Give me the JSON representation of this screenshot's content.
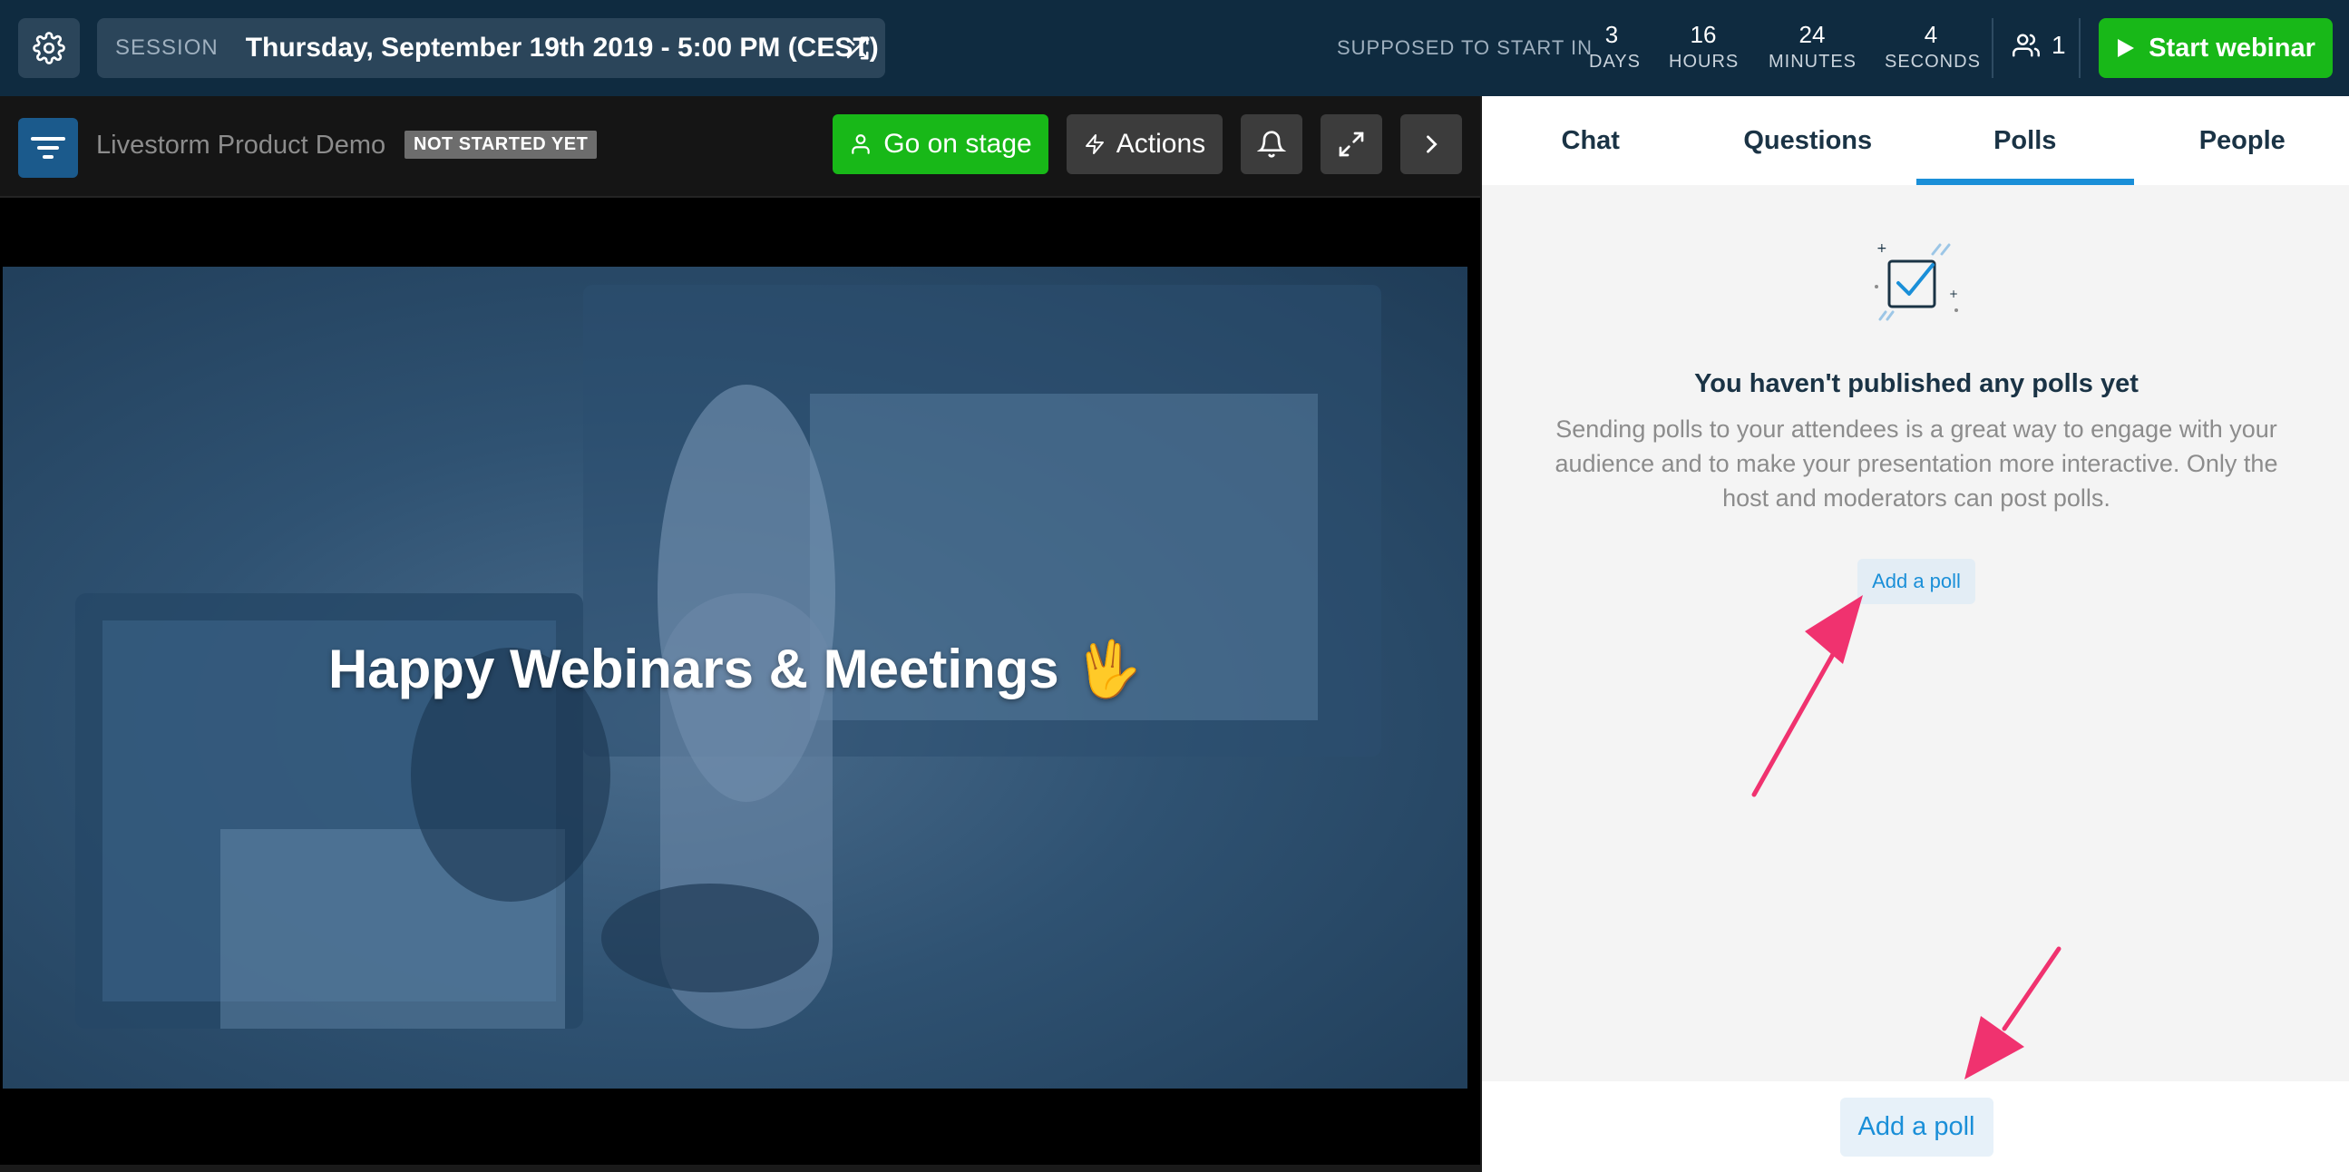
{
  "topbar": {
    "session_label": "SESSION",
    "session_date": "Thursday, September 19th 2019 - 5:00 PM (CEST)",
    "start_label": "SUPPOSED TO START IN",
    "countdown": [
      {
        "value": "3",
        "unit": "DAYS"
      },
      {
        "value": "16",
        "unit": "HOURS"
      },
      {
        "value": "24",
        "unit": "MINUTES"
      },
      {
        "value": "4",
        "unit": "SECONDS"
      }
    ],
    "attendee_count": "1",
    "start_button": "Start webinar"
  },
  "stage": {
    "event_name": "Livestorm Product Demo",
    "status_badge": "NOT STARTED YET",
    "go_on_stage": "Go on stage",
    "actions": "Actions",
    "video_title": "Happy Webinars & Meetings",
    "video_emoji": "🖖"
  },
  "panel": {
    "tabs": [
      {
        "label": "Chat"
      },
      {
        "label": "Questions"
      },
      {
        "label": "Polls",
        "active": true
      },
      {
        "label": "People"
      }
    ],
    "empty_title": "You haven't published any polls yet",
    "empty_desc": "Sending polls to your attendees is a great way to engage with your audience and to make your presentation more interactive. Only the host and moderators can post polls.",
    "add_poll_small": "Add a poll",
    "add_poll_large": "Add a poll"
  },
  "colors": {
    "topbar_bg": "#0f2b40",
    "green": "#18b818",
    "accent_blue": "#1a8fd8",
    "arrow_pink": "#f0326f"
  },
  "icons": [
    "gear-icon",
    "shuffle-icon",
    "users-icon",
    "play-icon",
    "menu-icon",
    "user-icon",
    "lightning-icon",
    "bell-icon",
    "expand-icon",
    "chevron-right-icon",
    "poll-checkbox-icon"
  ]
}
